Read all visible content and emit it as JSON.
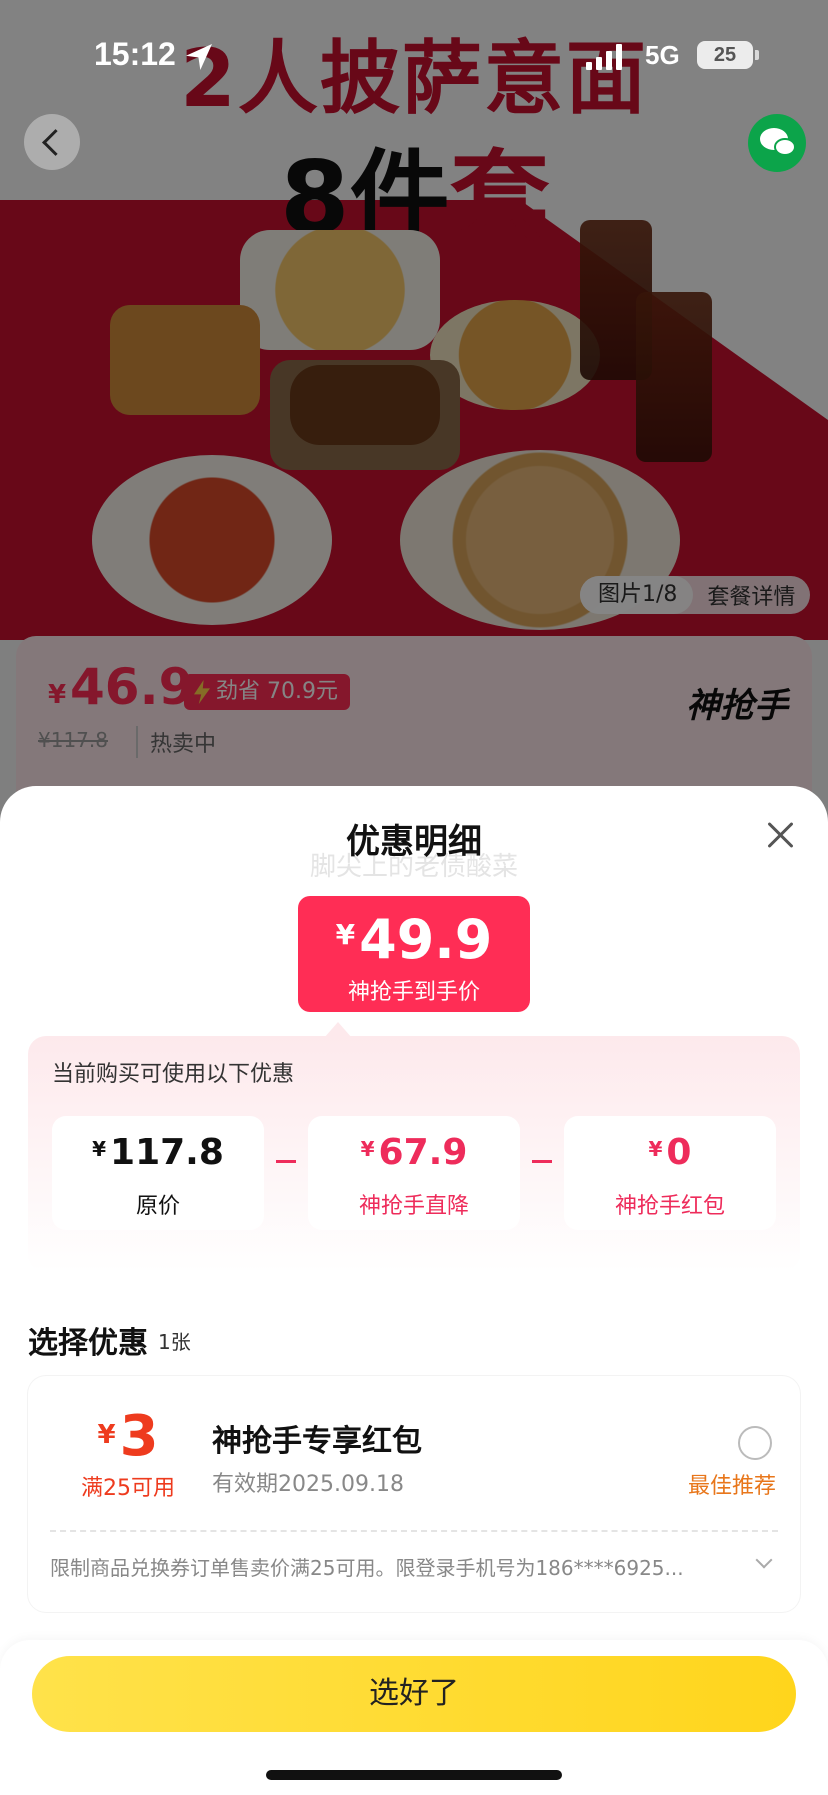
{
  "status_bar": {
    "time": "15:12",
    "network": "5G",
    "battery": "25"
  },
  "hero": {
    "title_line1": "2人披萨意面",
    "title_line2_black": "8件",
    "title_line2_red": "套",
    "pager": "图片1/8",
    "pager_tab": "套餐详情"
  },
  "product": {
    "yen": "¥",
    "price": "46.9",
    "saving": "劲省 70.9元",
    "original_price": "¥117.8",
    "status": "热卖中",
    "brand": "神抢手"
  },
  "sheet": {
    "title": "优惠明细",
    "subtitle_ghost": "脚尖上的老债酸菜",
    "final_price": {
      "yen": "¥",
      "amount": "49.9",
      "label": "神抢手到手价"
    },
    "discount_box": {
      "title": "当前购买可使用以下优惠",
      "items": [
        {
          "yen": "¥",
          "amount": "117.8",
          "label": "原价",
          "color": "#111111"
        },
        {
          "yen": "¥",
          "amount": "67.9",
          "label": "神抢手直降",
          "color": "#ee2c5b"
        },
        {
          "yen": "¥",
          "amount": "0",
          "label": "神抢手红包",
          "color": "#ee2c5b"
        }
      ],
      "operator": "-"
    },
    "select_section": {
      "title": "选择优惠",
      "count": "1张"
    },
    "coupon": {
      "yen": "¥",
      "amount": "3",
      "condition": "满25可用",
      "name": "神抢手专享红包",
      "expiry": "有效期2025.09.18",
      "recommend": "最佳推荐",
      "rule": "限制商品兑换券订单售卖价满25可用。限登录手机号为186****6925..."
    },
    "confirm_button": "选好了"
  },
  "colors": {
    "accent": "#ff2d55",
    "coupon": "#ee3b1e",
    "button": "#ffd51c",
    "recommend": "#e8761a"
  }
}
